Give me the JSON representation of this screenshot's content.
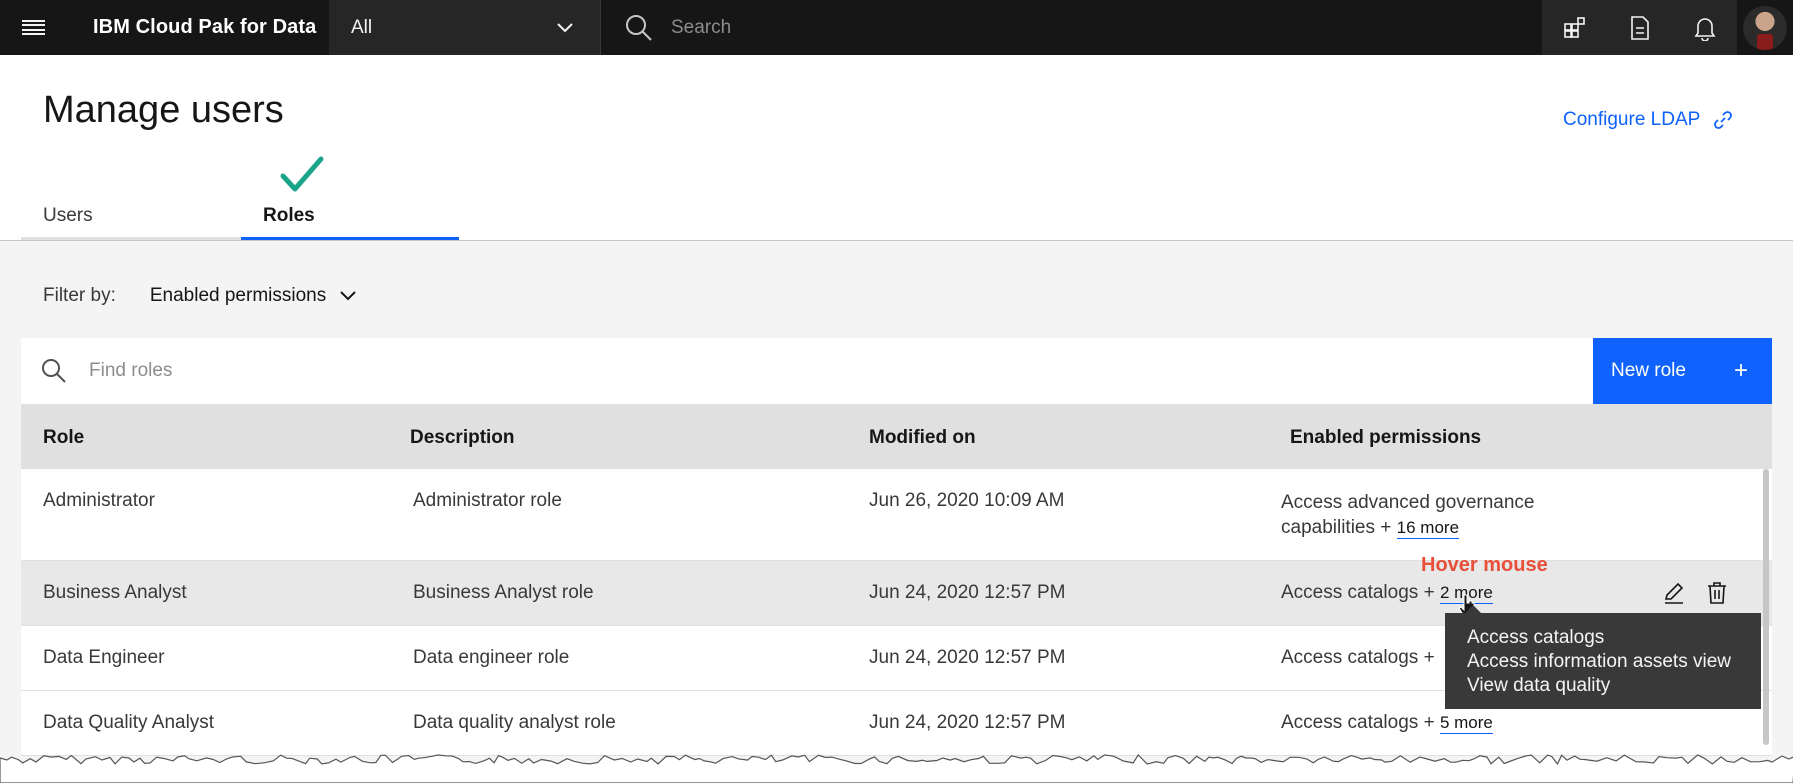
{
  "topbar": {
    "brand": "IBM Cloud Pak for Data",
    "scope": "All",
    "search_placeholder": "Search",
    "icons": [
      "menu-icon",
      "chevron-down-icon",
      "search-icon",
      "apps-icon",
      "document-icon",
      "notification-icon",
      "avatar"
    ]
  },
  "page": {
    "title": "Manage users",
    "configure_ldap": "Configure LDAP"
  },
  "tabs": [
    {
      "label": "Users",
      "selected": false
    },
    {
      "label": "Roles",
      "selected": true
    }
  ],
  "filter": {
    "label": "Filter by:",
    "value": "Enabled permissions"
  },
  "toolbar": {
    "find_placeholder": "Find roles",
    "new_role_label": "New role",
    "new_role_icon": "+"
  },
  "table": {
    "headers": [
      "Role",
      "Description",
      "Modified on",
      "Enabled permissions"
    ],
    "rows": [
      {
        "role": "Administrator",
        "description": "Administrator role",
        "modified": "Jun 26, 2020 10:09 AM",
        "perm_line1": "Access advanced governance",
        "perm_line2": "capabilities +",
        "more": "16 more"
      },
      {
        "role": "Business Analyst",
        "description": "Business Analyst role",
        "modified": "Jun 24, 2020 12:57 PM",
        "perm_line1": "Access catalogs +",
        "more": "2 more"
      },
      {
        "role": "Data Engineer",
        "description": "Data engineer role",
        "modified": "Jun 24, 2020 12:57 PM",
        "perm_line1": "Access catalogs +"
      },
      {
        "role": "Data Quality Analyst",
        "description": "Data quality analyst role",
        "modified": "Jun 24, 2020 12:57 PM",
        "perm_line1": "Access catalogs +",
        "more": "5 more"
      }
    ]
  },
  "tooltip": {
    "items": [
      "Access catalogs",
      "Access information assets view",
      "View data quality"
    ]
  },
  "annotation": {
    "hover_note": "Hover mouse"
  },
  "colors": {
    "primary": "#0f62fe",
    "topbar": "#161616",
    "annotation_red": "#e8503a",
    "checkmark": "#1aa58a"
  }
}
